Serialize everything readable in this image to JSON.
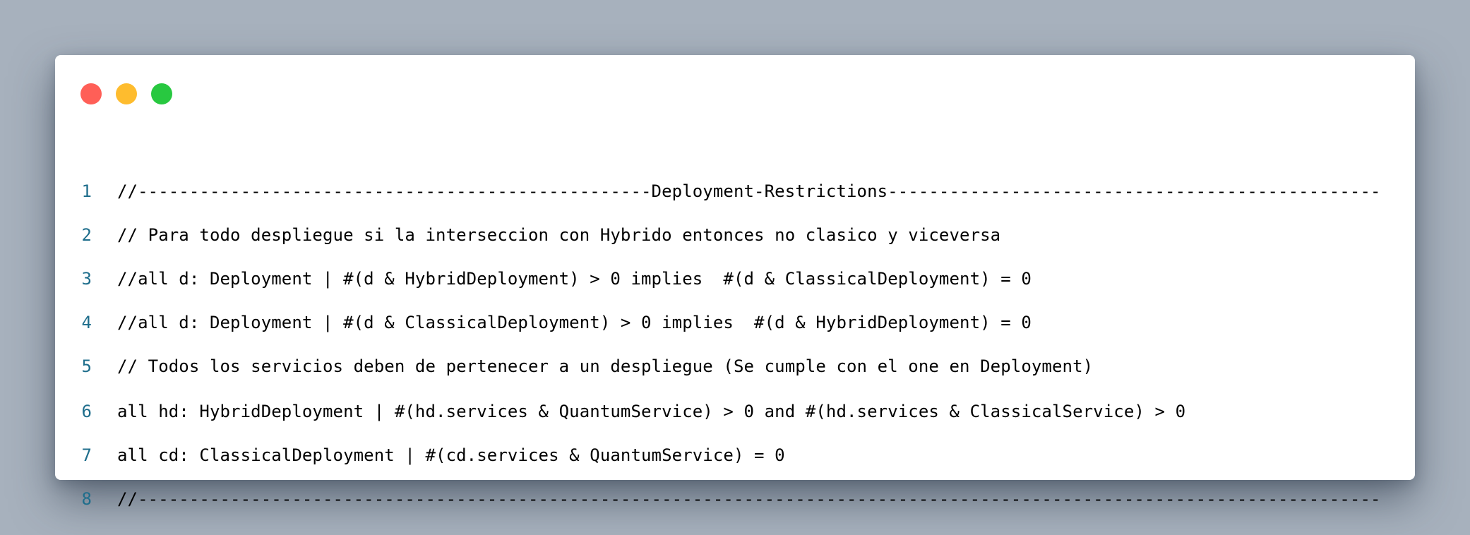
{
  "window": {
    "traffic_lights": [
      {
        "name": "close",
        "color": "#ff5f57"
      },
      {
        "name": "minimize",
        "color": "#febc2e"
      },
      {
        "name": "zoom",
        "color": "#28c840"
      }
    ]
  },
  "code": {
    "line_number_color": "#1f6e8c",
    "lines": [
      {
        "number": "1",
        "text": "//--------------------------------------------------Deployment-Restrictions------------------------------------------------"
      },
      {
        "number": "2",
        "text": "// Para todo despliegue si la interseccion con Hybrido entonces no clasico y viceversa"
      },
      {
        "number": "3",
        "text": "//all d: Deployment | #(d & HybridDeployment) > 0 implies  #(d & ClassicalDeployment) = 0"
      },
      {
        "number": "4",
        "text": "//all d: Deployment | #(d & ClassicalDeployment) > 0 implies  #(d & HybridDeployment) = 0"
      },
      {
        "number": "5",
        "text": "// Todos los servicios deben de pertenecer a un despliegue (Se cumple con el one en Deployment)"
      },
      {
        "number": "6",
        "text": "all hd: HybridDeployment | #(hd.services & QuantumService) > 0 and #(hd.services & ClassicalService) > 0"
      },
      {
        "number": "7",
        "text": "all cd: ClassicalDeployment | #(cd.services & QuantumService) = 0"
      },
      {
        "number": "8",
        "text": "//-------------------------------------------------------------------------------------------------------------------------"
      }
    ]
  }
}
